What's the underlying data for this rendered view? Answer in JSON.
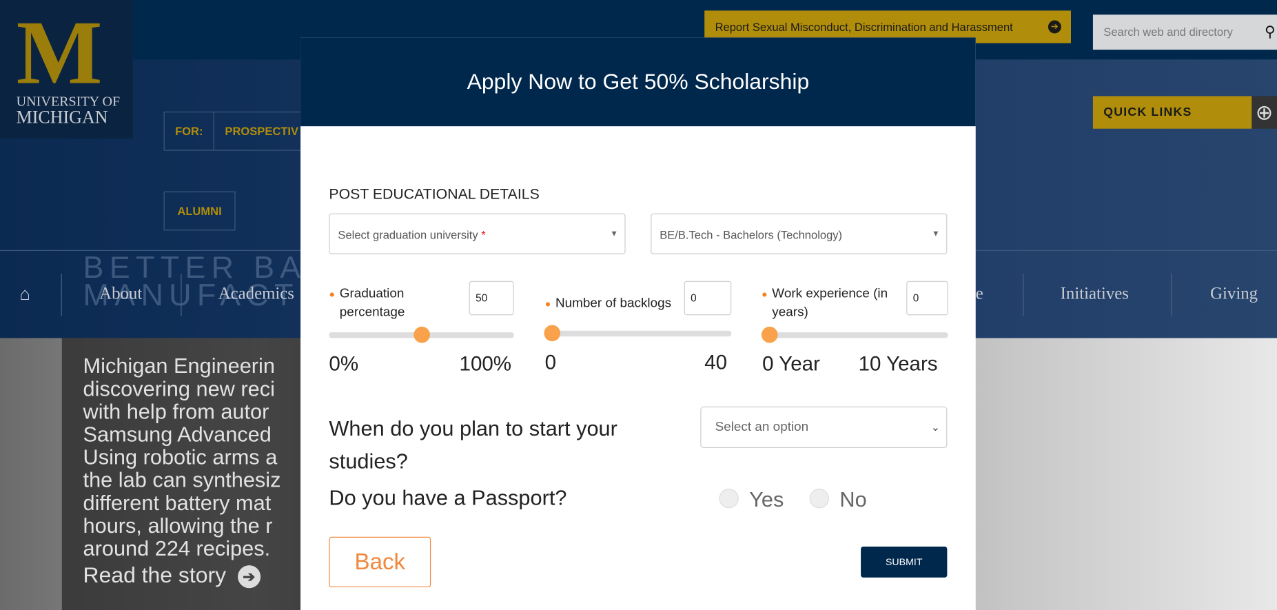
{
  "site": {
    "logo_m": "M",
    "logo_line1": "UNIVERSITY OF",
    "logo_line2": "MICHIGAN",
    "report": "Report Sexual Misconduct, Discrimination and Harassment",
    "search_placeholder": "Search web and directory",
    "for_label": "FOR:",
    "for_item": "PROSPECTIV",
    "alumni": "ALUMNI",
    "quick_links": "QUICK LINKS",
    "nav": [
      "About",
      "Academics",
      "e",
      "Initiatives",
      "Giving"
    ],
    "ghost_text": "BETTER BAT\nMANUFACTU",
    "story": "Michigan Engineerin\ndiscovering new reci\nwith help from autor\nSamsung Advanced \nUsing robotic arms a\nthe lab can synthesiz\ndifferent battery mat\nhours, allowing the r\naround 224 recipes.",
    "read_story": "Read the story"
  },
  "modal": {
    "title": "Apply Now to Get 50% Scholarship",
    "section": "POST EDUCATIONAL DETAILS",
    "university_placeholder": "Select graduation university",
    "required_mark": "*",
    "degree_value": "BE/B.Tech - Bachelors (Technology)",
    "sliders": [
      {
        "label": "Graduation percentage",
        "value": "50",
        "min_label": "0%",
        "max_label": "100%",
        "fraction": 0.5
      },
      {
        "label": "Number of backlogs",
        "value": "0",
        "min_label": "0",
        "max_label": "40",
        "fraction": 0
      },
      {
        "label": "Work experience (in years)",
        "value": "0",
        "min_label": "0 Year",
        "max_label": "10 Years",
        "fraction": 0
      }
    ],
    "start_question": "When do you plan to start your studies?",
    "start_placeholder": "Select an option",
    "passport_question": "Do you have a Passport?",
    "yes": "Yes",
    "no": "No",
    "back": "Back",
    "submit": "SUBMIT"
  },
  "colors": {
    "navy": "#00274c",
    "maize": "#b08d0a",
    "accent": "#f9a14b"
  }
}
